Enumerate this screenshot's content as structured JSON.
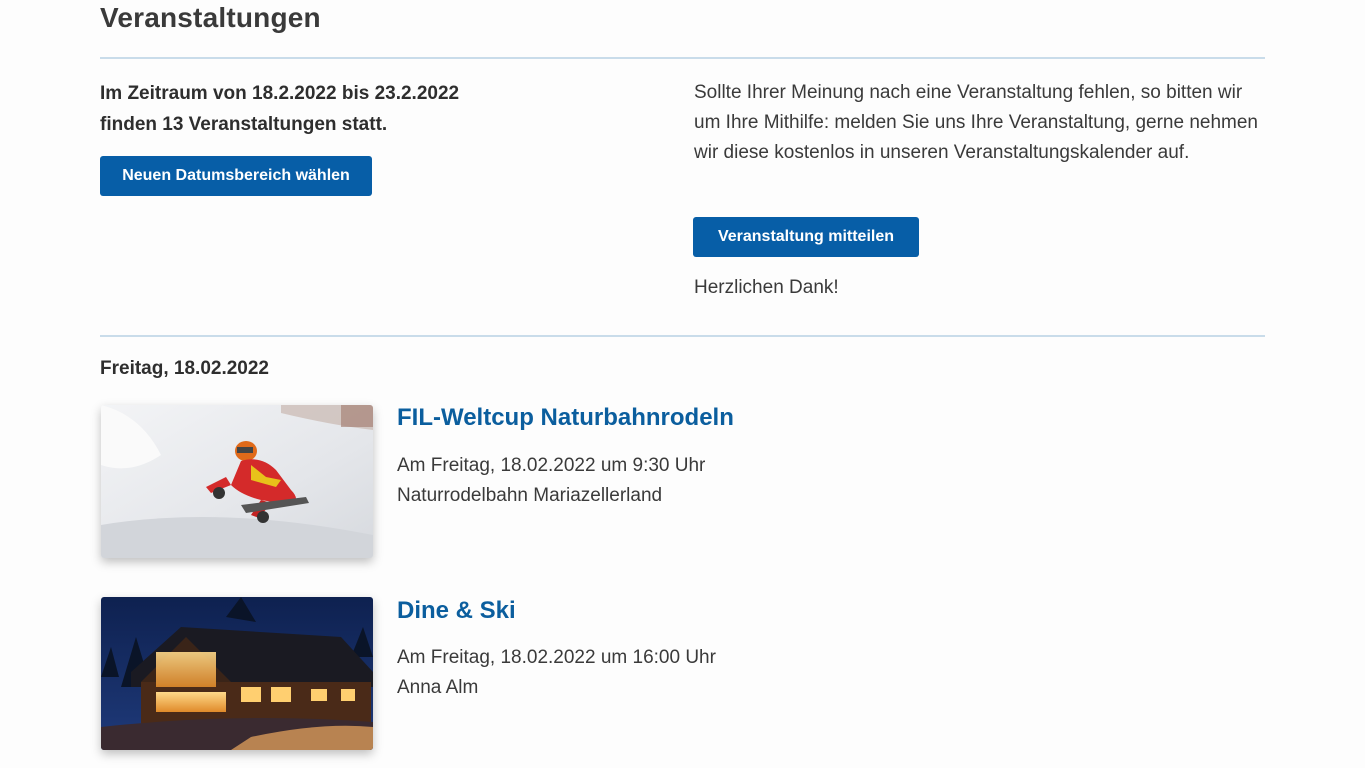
{
  "page": {
    "title": "Veranstaltungen"
  },
  "summary": {
    "line1": "Im Zeitraum von 18.2.2022 bis 23.2.2022",
    "line2": "finden 13 Veranstaltungen statt.",
    "date_button_label": "Neuen Datumsbereich wählen"
  },
  "notice": {
    "text": "Sollte Ihrer Meinung nach eine Veranstaltung fehlen, so bitten wir um Ihre Mithilfe: melden Sie uns Ihre Veranstaltung, gerne nehmen wir diese kostenlos in unseren Veranstaltungskalender auf.",
    "report_button_label": "Veranstaltung mitteilen",
    "thanks": "Herzlichen Dank!"
  },
  "day": {
    "heading": "Freitag, 18.02.2022",
    "events": [
      {
        "title": "FIL-Weltcup Naturbahnrodeln",
        "datetime": "Am Freitag, 18.02.2022 um 9:30 Uhr",
        "location": "Naturrodelbahn Mariazellerland",
        "image_icon": "luge-photo"
      },
      {
        "title": "Dine & Ski",
        "datetime": "Am Freitag, 18.02.2022 um 16:00 Uhr",
        "location": "Anna Alm",
        "image_icon": "cabin-night-photo"
      }
    ]
  },
  "colors": {
    "button": "#075ea7",
    "link": "#0b5e9e",
    "rule": "#c9dcea"
  }
}
